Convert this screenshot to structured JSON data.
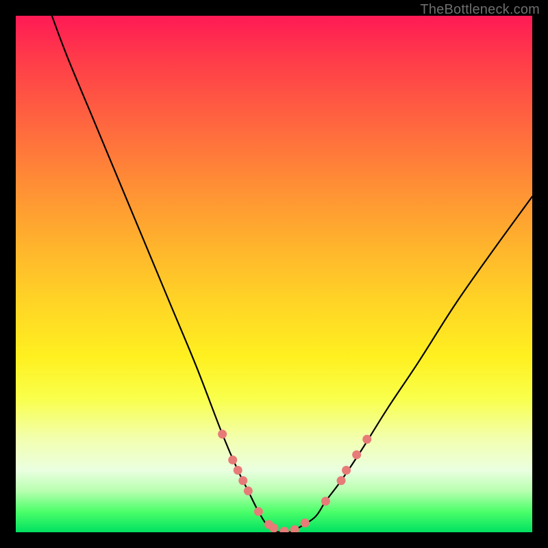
{
  "watermark": "TheBottleneck.com",
  "chart_data": {
    "type": "line",
    "title": "",
    "xlabel": "",
    "ylabel": "",
    "xlim": [
      0,
      100
    ],
    "ylim": [
      0,
      100
    ],
    "series": [
      {
        "name": "bottleneck-curve",
        "x": [
          7,
          10,
          15,
          20,
          25,
          30,
          35,
          40,
          43,
          45,
          47,
          49,
          51,
          53,
          55,
          58,
          60,
          63,
          67,
          72,
          78,
          85,
          92,
          100
        ],
        "y": [
          100,
          92,
          80,
          68,
          56,
          44,
          32,
          19,
          12,
          8,
          4,
          1,
          0,
          0,
          1,
          3,
          6,
          10,
          16,
          24,
          33,
          44,
          54,
          65
        ]
      }
    ],
    "markers": {
      "name": "highlight-points",
      "color": "#e77b78",
      "points": [
        {
          "x": 40,
          "y": 19
        },
        {
          "x": 42,
          "y": 14
        },
        {
          "x": 43,
          "y": 12
        },
        {
          "x": 44,
          "y": 10
        },
        {
          "x": 45,
          "y": 8
        },
        {
          "x": 47,
          "y": 4
        },
        {
          "x": 49,
          "y": 1.5
        },
        {
          "x": 50,
          "y": 0.8
        },
        {
          "x": 52,
          "y": 0.2
        },
        {
          "x": 54,
          "y": 0.5
        },
        {
          "x": 56,
          "y": 1.8
        },
        {
          "x": 60,
          "y": 6
        },
        {
          "x": 63,
          "y": 10
        },
        {
          "x": 64,
          "y": 12
        },
        {
          "x": 66,
          "y": 15
        },
        {
          "x": 68,
          "y": 18
        }
      ]
    }
  }
}
